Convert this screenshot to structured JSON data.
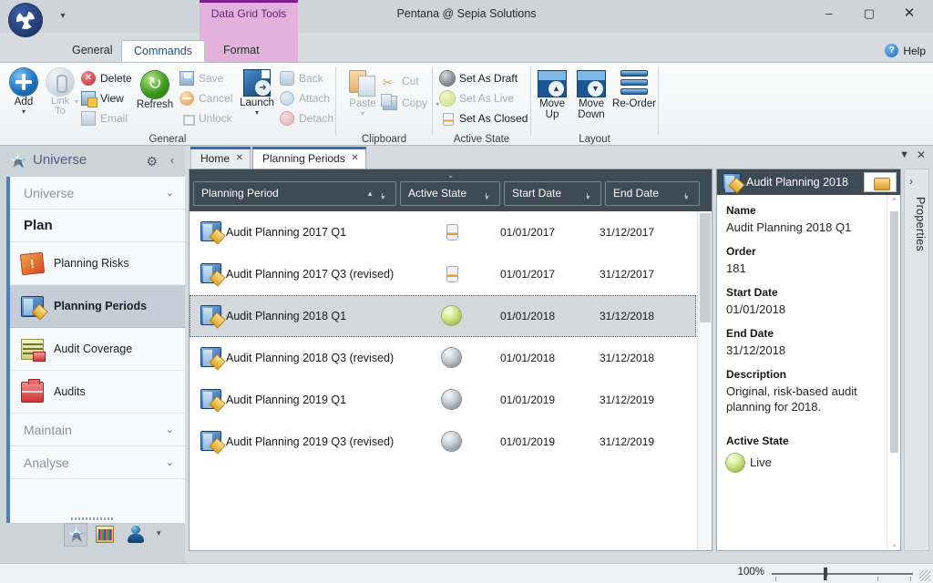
{
  "window": {
    "title": "Pentana @ Sepia Solutions",
    "minimize": "–",
    "maximize": "▢",
    "close": "✕",
    "qat_dropdown": "qat-dropdown"
  },
  "ribbon": {
    "contextual_group": "Data Grid Tools",
    "tabs": [
      {
        "label": "General",
        "selected": false
      },
      {
        "label": "Commands",
        "selected": true
      },
      {
        "label": "Format",
        "selected": false
      }
    ],
    "help": "Help",
    "groups": [
      {
        "name": "General",
        "big_buttons": [
          {
            "label": "Add",
            "caret": "▾",
            "disabled": false
          },
          {
            "label": "Link To",
            "caret": "▾",
            "disabled": true
          },
          {
            "label": "Refresh",
            "caret": "",
            "disabled": false
          },
          {
            "label": "Launch",
            "caret": "▾",
            "disabled": false
          }
        ],
        "small_buttons": [
          {
            "label": "Delete",
            "disabled": false
          },
          {
            "label": "View",
            "disabled": false
          },
          {
            "label": "Email",
            "disabled": true
          },
          {
            "label": "Save",
            "disabled": true
          },
          {
            "label": "Cancel",
            "disabled": true
          },
          {
            "label": "Unlock",
            "disabled": true
          },
          {
            "label": "Back",
            "disabled": true
          },
          {
            "label": "Attach",
            "disabled": true
          },
          {
            "label": "Detach",
            "disabled": true
          }
        ]
      },
      {
        "name": "Clipboard",
        "big_buttons": [
          {
            "label": "Paste",
            "caret": "▾",
            "disabled": true
          }
        ],
        "small_buttons": [
          {
            "label": "Cut",
            "disabled": true
          },
          {
            "label": "Copy",
            "disabled": true,
            "caret": "▾"
          }
        ]
      },
      {
        "name": "Active State",
        "small_buttons": [
          {
            "label": "Set As Draft",
            "disabled": false
          },
          {
            "label": "Set As Live",
            "disabled": true
          },
          {
            "label": "Set As Closed",
            "disabled": false
          }
        ]
      },
      {
        "name": "Layout",
        "big_buttons": [
          {
            "label": "Move Up",
            "disabled": false
          },
          {
            "label": "Move Down",
            "disabled": false
          },
          {
            "label": "Re-Order",
            "disabled": false
          }
        ]
      }
    ]
  },
  "sidebar": {
    "title": "Universe",
    "gear": "⚙",
    "collapse": "‹",
    "entries": [
      {
        "kind": "group",
        "label": "Universe",
        "chevron": "⌄"
      },
      {
        "kind": "section",
        "label": "Plan"
      },
      {
        "kind": "item",
        "label": "Planning Risks",
        "icon": "planning-risks-icon",
        "active": false
      },
      {
        "kind": "item",
        "label": "Planning Periods",
        "icon": "planning-periods-icon",
        "active": true
      },
      {
        "kind": "item",
        "label": "Audit Coverage",
        "icon": "audit-coverage-icon",
        "active": false
      },
      {
        "kind": "item",
        "label": "Audits",
        "icon": "audits-icon",
        "active": false
      },
      {
        "kind": "group",
        "label": "Maintain",
        "chevron": "⌄"
      },
      {
        "kind": "group",
        "label": "Analyse",
        "chevron": "⌄"
      }
    ],
    "footer_icons": [
      "universe-icon",
      "analysis-icon",
      "user-icon"
    ],
    "footer_dropdown": "▾"
  },
  "workspace": {
    "tabs": [
      {
        "label": "Home",
        "selected": false,
        "close": "✕"
      },
      {
        "label": "Planning Periods",
        "selected": true,
        "close": "✕"
      }
    ],
    "dropdown": "▼",
    "close": "✕"
  },
  "grid": {
    "expander": "⌄",
    "columns": [
      {
        "label": "Planning Period",
        "sort": "▲",
        "filter": true
      },
      {
        "label": "Active State",
        "sort": "",
        "filter": true
      },
      {
        "label": "Start Date",
        "sort": "",
        "filter": true
      },
      {
        "label": "End Date",
        "sort": "",
        "filter": true
      }
    ],
    "rows": [
      {
        "name": "Audit Planning 2017 Q1",
        "state": "Closed",
        "start": "01/01/2017",
        "end": "31/12/2017",
        "selected": false
      },
      {
        "name": "Audit Planning 2017 Q3 (revised)",
        "state": "Closed",
        "start": "01/01/2017",
        "end": "31/12/2017",
        "selected": false
      },
      {
        "name": "Audit Planning 2018 Q1",
        "state": "Live",
        "start": "01/01/2018",
        "end": "31/12/2018",
        "selected": true
      },
      {
        "name": "Audit Planning 2018 Q3 (revised)",
        "state": "Draft",
        "start": "01/01/2018",
        "end": "31/12/2018",
        "selected": false
      },
      {
        "name": "Audit Planning 2019 Q1",
        "state": "Draft",
        "start": "01/01/2019",
        "end": "31/12/2019",
        "selected": false
      },
      {
        "name": "Audit Planning 2019 Q3 (revised)",
        "state": "Draft",
        "start": "01/01/2019",
        "end": "31/12/2019",
        "selected": false
      }
    ]
  },
  "properties": {
    "header_title": "Audit Planning 2018",
    "tab_label": "Properties",
    "tab_expand": "›",
    "scroll_up": "⌃",
    "scroll_down": "⌄",
    "fields": [
      {
        "label": "Name",
        "value": "Audit Planning 2018 Q1"
      },
      {
        "label": "Order",
        "value": "181"
      },
      {
        "label": "Start Date",
        "value": "01/01/2018"
      },
      {
        "label": "End Date",
        "value": "31/12/2018"
      },
      {
        "label": "Description",
        "value": "Original, risk-based audit planning for 2018."
      },
      {
        "label": "Active State",
        "value": "Live"
      }
    ]
  },
  "statusbar": {
    "zoom": "100%"
  }
}
